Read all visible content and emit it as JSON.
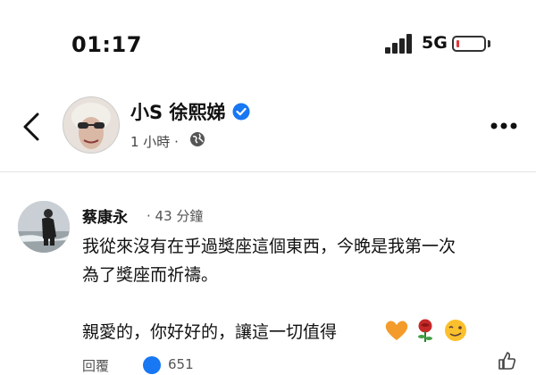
{
  "status_bar": {
    "time": "01:17",
    "network": "5G",
    "battery_level": 0.1,
    "battery_color": "#e53935",
    "signal_icon": "cellular-signal-icon"
  },
  "post": {
    "author": "小S 徐熙娣",
    "verified": true,
    "verified_color": "#1877f2",
    "time": "1 小時 ·",
    "audience_icon": "globe-icon"
  },
  "comment": {
    "author": "蔡康永",
    "time": "· 43 分鐘",
    "lines": [
      "我從來沒有在乎過獎座這個東西，今晚是我第一次",
      "為了獎座而祈禱。",
      "親愛的，你好好的，讓這一切值得"
    ],
    "emojis": [
      "orange-heart-icon",
      "rose-icon",
      "winking-face-icon"
    ],
    "reply_label": "回覆",
    "like_count": "651"
  }
}
